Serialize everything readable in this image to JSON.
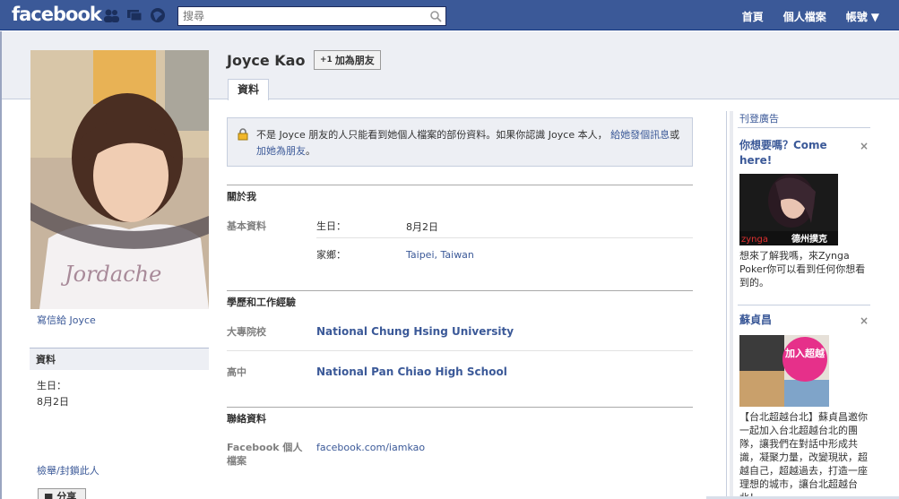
{
  "topbar": {
    "logo": "facebook",
    "search_placeholder": "搜尋",
    "nav": [
      "首頁",
      "個人檔案",
      "帳號"
    ],
    "jewels": [
      "friend-requests-icon",
      "messages-icon",
      "notifications-icon"
    ],
    "bg_color": "#3b5998"
  },
  "profile": {
    "name": "Joyce Kao",
    "add_friend": "加為朋友",
    "tab": "資料",
    "send_message": "寫信給  Joyce",
    "left_box_title": "資料",
    "left_birthday_label": "生日：",
    "left_birthday_value": "8月2日",
    "block": "檢舉/封鎖此人",
    "share": "分享"
  },
  "notice": {
    "text": "不是  Joyce 朋友的人只能看到她個人檔案的部份資料。如果你認識  Joyce 本人，",
    "link1": "給她發個訊息",
    "or": "或",
    "link2": "加她為朋友",
    "end": "。"
  },
  "about": {
    "title": "關於我",
    "basic_label": "基本資料",
    "birthday_label": "生日：",
    "birthday_value": "8月2日",
    "hometown_label": "家鄉：",
    "hometown_value": "Taipei, Taiwan"
  },
  "education": {
    "title": "學歷和工作經驗",
    "college_label": "大專院校",
    "college_value": "National Chung Hsing University",
    "highschool_label": "高中",
    "highschool_value": "National Pan Chiao High School"
  },
  "contact": {
    "title": "聯絡資料",
    "fb_label": "Facebook 個人檔案",
    "fb_value": "facebook.com/iamkao"
  },
  "ads": {
    "header_link": "刊登廣告",
    "ad1_title": "你想要嗎？Come here!",
    "ad1_image_text": "德州撲克",
    "ad1_brand": "zynga",
    "ad1_desc": "想來了解我嗎，來Zynga Poker你可以看到任何你想看到的。",
    "ad2_title": "蘇貞昌",
    "ad2_image_text": "加入超越",
    "ad2_desc": "【台北超越台北】蘇貞昌邀你一起加入台北超越台北的團隊，讓我們在對話中形成共識，凝聚力量，改變現狀，超越自己，超越過去，打造一座理想的城市，讓台北超越台北！",
    "close": "×"
  }
}
